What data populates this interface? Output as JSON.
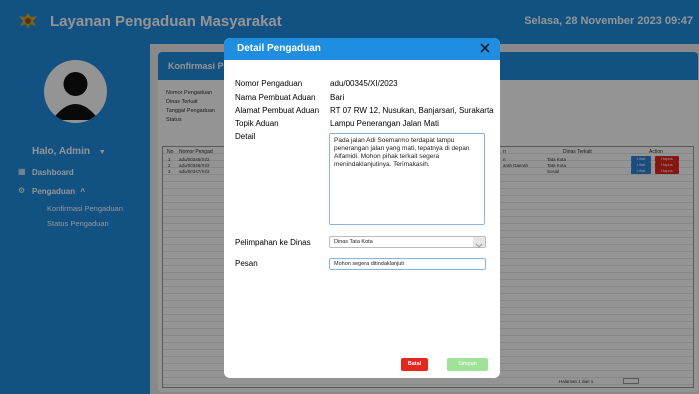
{
  "header": {
    "app_title": "Layanan Pengaduan Masyarakat",
    "date_time": "Selasa, 28 November 2023 09:47"
  },
  "sidebar": {
    "greeting": "Halo, Admin",
    "items": [
      {
        "label": "Dashboard",
        "icon": "grid-icon"
      },
      {
        "label": "Pengaduan",
        "icon": "gear-icon"
      }
    ],
    "subitems": [
      {
        "label": "Konfirmasi Pengaduan"
      },
      {
        "label": "Status Pengaduan"
      }
    ]
  },
  "page": {
    "title": "Konfirmasi Pen",
    "info_labels": [
      "Nomor Pengaduan",
      "Dinas Terkait",
      "Tanggal Pengaduan",
      "Status"
    ],
    "table": {
      "headers": [
        "No",
        "Nomor Pengad",
        "n",
        "Dinas Terkait",
        "Action"
      ],
      "rows": [
        {
          "no": "1",
          "nomor": "adu/00345/XI/2",
          "mid": "n",
          "dinas": "Tata Kota"
        },
        {
          "no": "2",
          "nomor": "adu/00346/XI/2",
          "mid": "arah Daerah",
          "dinas": "Tata Kota"
        },
        {
          "no": "3",
          "nomor": "adu/00347/XI/2",
          "mid": "",
          "dinas": "Sosial"
        }
      ],
      "action_labels": [
        "Lihat",
        "Hapus"
      ],
      "footer": "Halaman 1 dari 1"
    }
  },
  "modal": {
    "title": "Detail Pengaduan",
    "fields": {
      "nomor_label": "Nomor Pengaduan",
      "nomor_value": "adu/00345/XI/2023",
      "nama_label": "Nama Pembuat Aduan",
      "nama_value": "Bari",
      "alamat_label": "Alamat Pembuat Aduan",
      "alamat_value": "RT 07 RW 12, Nusukan, Banjarsari, Surakarta",
      "topik_label": "Topik Aduan",
      "topik_value": "Lampu Penerangan Jalan Mati",
      "detail_label": "Detail",
      "detail_value": "Pada jalan Adi Soemarmo terdapat lampu penerangan jalan yang mati, tepatnya di depan Alfamidi. Mohon pihak terkait segera menindaklanjutinya. Terimakasih.",
      "pelimpahan_label": "Pelimpahan ke Dinas",
      "pelimpahan_value": "Dinas Tata Kota",
      "pesan_label": "Pesan",
      "pesan_value": "Mohon segera ditindaklanjuti"
    },
    "cancel_label": "Batal",
    "save_label": "Simpan"
  },
  "colors": {
    "primary": "#1f8ee0",
    "danger": "#e8261d",
    "success": "#9fe39a"
  }
}
